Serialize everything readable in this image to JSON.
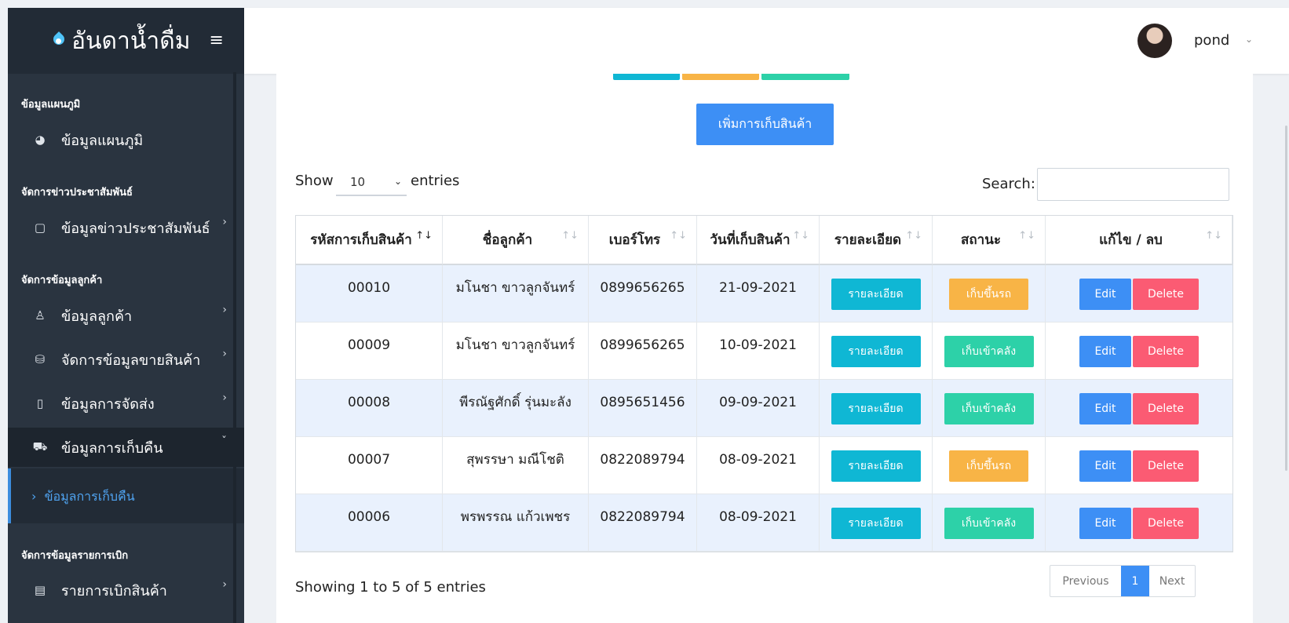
{
  "brand": {
    "title": "อันดาน้ำดื่ม"
  },
  "sidebar": {
    "sections": [
      {
        "title": "ข้อมูลแผนภูมิ"
      },
      {
        "title": "จัดการข่าวประชาสัมพันธ์"
      },
      {
        "title": "จัดการข้อมูลลูกค้า"
      },
      {
        "title": "จัดการข้อมูลรายการเบิก"
      }
    ],
    "items": [
      {
        "label": "ข้อมูลแผนภูมิ",
        "icon": "pie-chart-icon"
      },
      {
        "label": "ข้อมูลข่าวประชาสัมพันธ์",
        "icon": "clipboard-icon"
      },
      {
        "label": "ข้อมูลลูกค้า",
        "icon": "user-icon"
      },
      {
        "label": "จัดการข้อมูลขายสินค้า",
        "icon": "shopping-bag-icon"
      },
      {
        "label": "ข้อมูลการจัดส่ง",
        "icon": "clipboard-icon"
      },
      {
        "label": "ข้อมูลการเก็บคืน",
        "icon": "truck-icon"
      },
      {
        "label": "รายการเบิกสินค้า",
        "icon": "newspaper-icon"
      }
    ],
    "sub_item": {
      "label": "ข้อมูลการเก็บคืน"
    }
  },
  "topbar": {
    "username": "pond"
  },
  "main": {
    "top_button_colors": [
      "#0fb7d4",
      "#f8b446",
      "#2dd1a8"
    ],
    "add_button_label": "เพิ่มการเก็บสินค้า",
    "show_label": "Show",
    "entries_value": "10",
    "entries_label": "entries",
    "search_label": "Search:",
    "search_value": "",
    "columns": [
      "รหัสการเก็บสินค้า",
      "ชื่อลูกค้า",
      "เบอร์โทร",
      "วันที่เก็บสินค้า",
      "รายละเอียด",
      "สถานะ",
      "แก้ไข / ลบ"
    ],
    "rows": [
      {
        "id": "00010",
        "customer": "มโนชา ขาวลูกจันทร์",
        "phone": "0899656265",
        "date": "21-09-2021",
        "detail": "รายละเอียด",
        "status": "เก็บขึ้นรถ",
        "status_type": "truck",
        "edit": "Edit",
        "delete": "Delete"
      },
      {
        "id": "00009",
        "customer": "มโนชา ขาวลูกจันทร์",
        "phone": "0899656265",
        "date": "10-09-2021",
        "detail": "รายละเอียด",
        "status": "เก็บเข้าคลัง",
        "status_type": "store",
        "edit": "Edit",
        "delete": "Delete"
      },
      {
        "id": "00008",
        "customer": "พีรณัฐศักดิ์ รุ่นมะลัง",
        "phone": "0895651456",
        "date": "09-09-2021",
        "detail": "รายละเอียด",
        "status": "เก็บเข้าคลัง",
        "status_type": "store",
        "edit": "Edit",
        "delete": "Delete"
      },
      {
        "id": "00007",
        "customer": "สุพรรษา มณีโชติ",
        "phone": "0822089794",
        "date": "08-09-2021",
        "detail": "รายละเอียด",
        "status": "เก็บขึ้นรถ",
        "status_type": "truck",
        "edit": "Edit",
        "delete": "Delete"
      },
      {
        "id": "00006",
        "customer": "พรพรรณ แก้วเพชร",
        "phone": "0822089794",
        "date": "08-09-2021",
        "detail": "รายละเอียด",
        "status": "เก็บเข้าคลัง",
        "status_type": "store",
        "edit": "Edit",
        "delete": "Delete"
      }
    ],
    "showing_text": "Showing 1 to 5 of 5 entries",
    "pagination": {
      "previous": "Previous",
      "current": "1",
      "next": "Next"
    }
  }
}
